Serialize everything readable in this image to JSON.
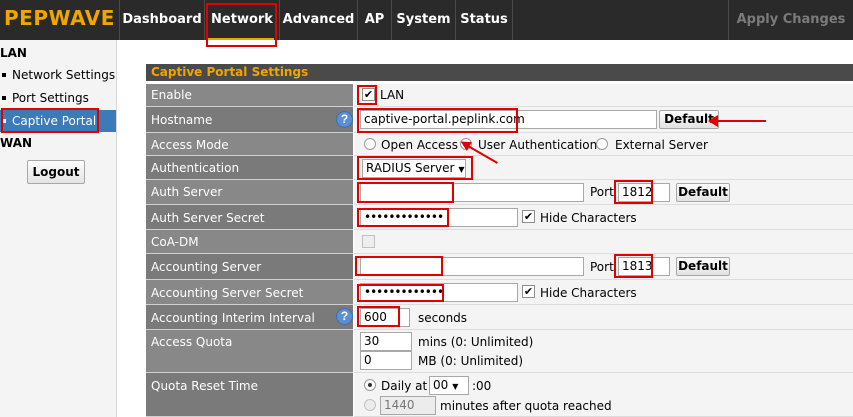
{
  "brand": "PEPWAVE",
  "nav": {
    "tabs": [
      "Dashboard",
      "Network",
      "Advanced",
      "AP",
      "System",
      "Status"
    ],
    "active": "Network",
    "apply_label": "Apply Changes"
  },
  "sidebar": {
    "lan_heading": "LAN",
    "items": [
      "Network Settings",
      "Port Settings",
      "Captive Portal"
    ],
    "active_item": "Captive Portal",
    "wan_heading": "WAN",
    "logout_label": "Logout"
  },
  "form": {
    "title": "Captive Portal Settings",
    "enable": {
      "label": "Enable",
      "checked": true,
      "option": "LAN"
    },
    "hostname": {
      "label": "Hostname",
      "value": "captive-portal.peplink.com",
      "default_label": "Default"
    },
    "access_mode": {
      "label": "Access Mode",
      "options": [
        "Open Access",
        "User Authentication",
        "External Server"
      ],
      "selected": "User Authentication"
    },
    "authentication": {
      "label": "Authentication",
      "value": "RADIUS Server"
    },
    "auth_server": {
      "label": "Auth Server",
      "value": "",
      "port_label": "Port",
      "port": "1812",
      "default_label": "Default"
    },
    "auth_secret": {
      "label": "Auth Server Secret",
      "value": "•••••••••••••",
      "hide_checked": true,
      "hide_label": "Hide Characters"
    },
    "coa_dm": {
      "label": "CoA-DM",
      "checked": false
    },
    "acct_server": {
      "label": "Accounting Server",
      "value": "",
      "port_label": "Port",
      "port": "1813",
      "default_label": "Default"
    },
    "acct_secret": {
      "label": "Accounting Server Secret",
      "value": "•••••••••••••",
      "hide_checked": true,
      "hide_label": "Hide Characters"
    },
    "interim": {
      "label": "Accounting Interim Interval",
      "value": "600",
      "unit": "seconds"
    },
    "quota": {
      "label": "Access Quota",
      "mins_value": "30",
      "mins_unit": "mins (0: Unlimited)",
      "mb_value": "0",
      "mb_unit": "MB (0: Unlimited)"
    },
    "reset": {
      "label": "Quota Reset Time",
      "daily_label": "Daily at",
      "hour": "00",
      "minute_suffix": ":00",
      "minutes_value": "1440",
      "minutes_label": "minutes after quota reached"
    }
  },
  "colors": {
    "brand": "#f0a500",
    "nav_bg": "#2a2a2a",
    "label_bg": "#888888",
    "active_blue": "#3d7ab8",
    "annotation_red": "#e00000"
  },
  "icons": [
    "help-icon",
    "checkbox-checked-icon",
    "radio-icon",
    "dropdown-arrow-icon"
  ]
}
